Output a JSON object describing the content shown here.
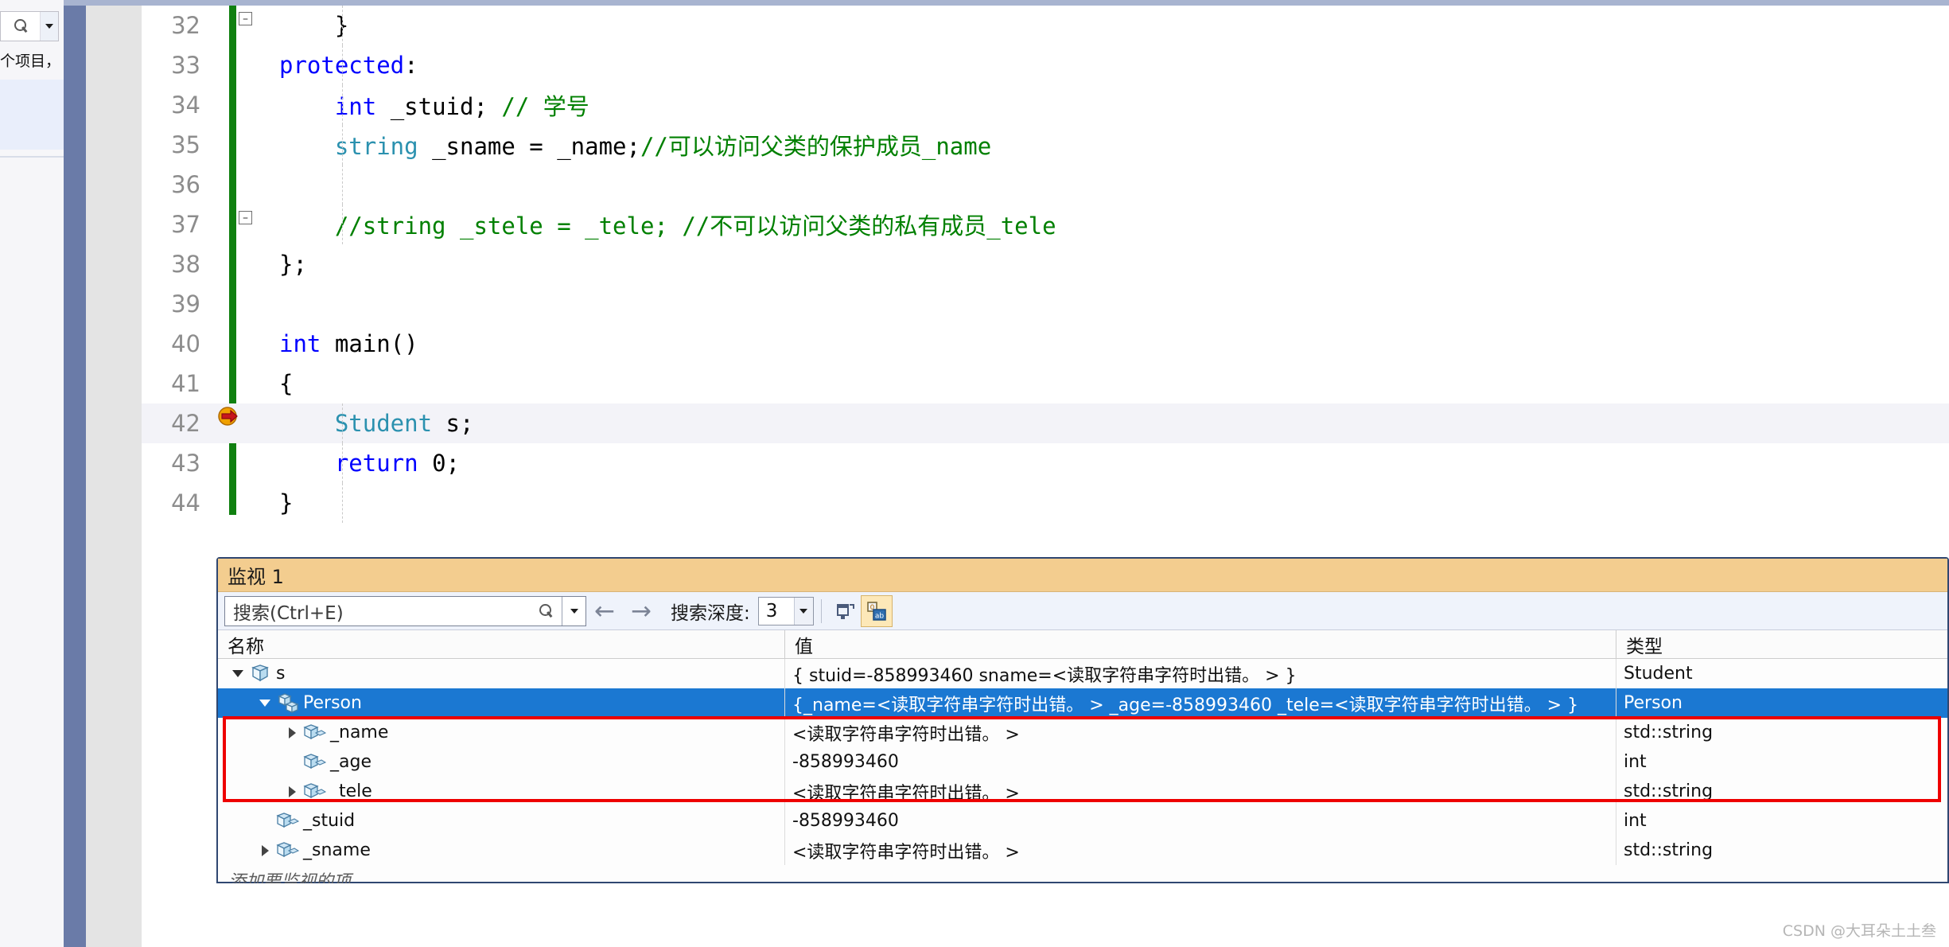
{
  "left_panel": {
    "search_icon": "search-icon",
    "dropdown_icon": "chevron-down-icon",
    "project_text": "个项目，"
  },
  "editor": {
    "change_bar_color": "#108010",
    "current_line": 42,
    "exec_marker_icon": "current-statement-arrow-icon",
    "lines": [
      {
        "no": "32",
        "indent": 2,
        "tokens": [
          {
            "t": "    }",
            "c": "plain"
          }
        ]
      },
      {
        "no": "33",
        "indent": 0,
        "tokens": [
          {
            "t": "protected",
            "c": "kw"
          },
          {
            "t": ":",
            "c": "plain"
          }
        ]
      },
      {
        "no": "34",
        "indent": 0,
        "tokens": [
          {
            "t": "    ",
            "c": "plain"
          },
          {
            "t": "int",
            "c": "kw"
          },
          {
            "t": " _stuid; ",
            "c": "plain"
          },
          {
            "t": "// 学号",
            "c": "cmt"
          }
        ]
      },
      {
        "no": "35",
        "indent": 0,
        "tokens": [
          {
            "t": "    ",
            "c": "plain"
          },
          {
            "t": "string",
            "c": "type"
          },
          {
            "t": " _sname = _name;",
            "c": "plain"
          },
          {
            "t": "//可以访问父类的保护成员_name",
            "c": "cmt"
          }
        ]
      },
      {
        "no": "36",
        "indent": 0,
        "tokens": [
          {
            "t": "",
            "c": "plain"
          }
        ]
      },
      {
        "no": "37",
        "indent": 0,
        "tokens": [
          {
            "t": "    ",
            "c": "plain"
          },
          {
            "t": "//string _stele = _tele; //不可以访问父类的私有成员_tele",
            "c": "cmt"
          }
        ]
      },
      {
        "no": "38",
        "indent": 0,
        "tokens": [
          {
            "t": "};",
            "c": "plain"
          }
        ]
      },
      {
        "no": "39",
        "indent": 0,
        "tokens": [
          {
            "t": "",
            "c": "plain"
          }
        ]
      },
      {
        "no": "40",
        "indent": 0,
        "tokens": [
          {
            "t": "int",
            "c": "kw"
          },
          {
            "t": " ",
            "c": "plain"
          },
          {
            "t": "main",
            "c": "plain"
          },
          {
            "t": "()",
            "c": "plain"
          }
        ]
      },
      {
        "no": "41",
        "indent": 0,
        "tokens": [
          {
            "t": "{",
            "c": "plain"
          }
        ]
      },
      {
        "no": "42",
        "indent": 0,
        "tokens": [
          {
            "t": "    ",
            "c": "plain"
          },
          {
            "t": "Student",
            "c": "type"
          },
          {
            "t": " s;",
            "c": "plain"
          }
        ]
      },
      {
        "no": "43",
        "indent": 0,
        "tokens": [
          {
            "t": "    ",
            "c": "plain"
          },
          {
            "t": "return",
            "c": "kw"
          },
          {
            "t": " ",
            "c": "plain"
          },
          {
            "t": "0",
            "c": "plain"
          },
          {
            "t": ";",
            "c": "plain"
          }
        ]
      },
      {
        "no": "44",
        "indent": 0,
        "tokens": [
          {
            "t": "}",
            "c": "plain"
          }
        ]
      }
    ]
  },
  "watch": {
    "title": "监视 1",
    "toolbar": {
      "search_placeholder": "搜索(Ctrl+E)",
      "search_value": "",
      "search_icon": "search-icon",
      "search_dropdown_icon": "chevron-down-icon",
      "prev_icon": "arrow-left-icon",
      "next_icon": "arrow-right-icon",
      "depth_label": "搜索深度:",
      "depth_value": "3",
      "depth_caret_icon": "chevron-down-icon",
      "pin_icon": "pin-tool-icon",
      "hex_icon": "hex-display-icon"
    },
    "columns": [
      "名称",
      "值",
      "类型"
    ],
    "rows": [
      {
        "indent": 0,
        "expander": "down",
        "icon": "variable-icon",
        "name": "s",
        "value": "{ stuid=-858993460  sname=<读取字符串字符时出错。 > }",
        "type": "Student",
        "selected": false
      },
      {
        "indent": 1,
        "expander": "down",
        "icon": "base-class-icon",
        "name": "Person",
        "value": "{_name=<读取字符串字符时出错。 > _age=-858993460 _tele=<读取字符串字符时出错。 > }",
        "type": "Person",
        "selected": true
      },
      {
        "indent": 2,
        "expander": "right",
        "icon": "field-icon",
        "name": "_name",
        "value": "<读取字符串字符时出错。 >",
        "type": "std::string",
        "selected": false
      },
      {
        "indent": 2,
        "expander": "none",
        "icon": "field-icon",
        "name": "_age",
        "value": "-858993460",
        "type": "int",
        "selected": false
      },
      {
        "indent": 2,
        "expander": "right",
        "icon": "field-icon",
        "name": "_tele",
        "value": "<读取字符串字符时出错。 >",
        "type": "std::string",
        "selected": false
      },
      {
        "indent": 1,
        "expander": "none",
        "icon": "field-icon",
        "name": "_stuid",
        "value": "-858993460",
        "type": "int",
        "selected": false
      },
      {
        "indent": 1,
        "expander": "right",
        "icon": "field-icon",
        "name": "_sname",
        "value": "<读取字符串字符时出错。 >",
        "type": "std::string",
        "selected": false
      }
    ],
    "add_row_placeholder": "添加要监视的项",
    "annotation_color": "#ee0000"
  },
  "watermark": "CSDN @大耳朵土土叁"
}
